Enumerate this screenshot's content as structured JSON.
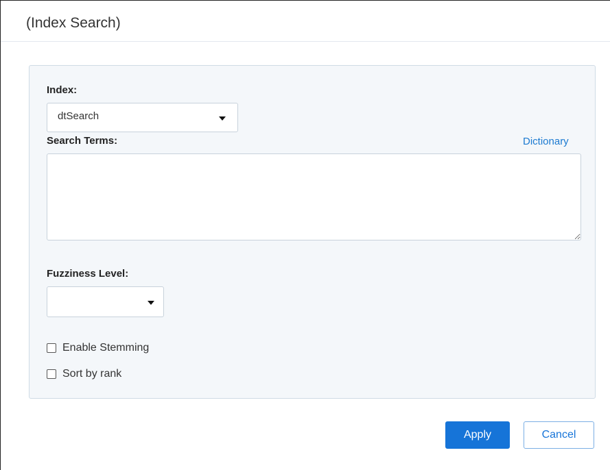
{
  "dialog": {
    "title": "(Index Search)"
  },
  "form": {
    "index_label": "Index:",
    "index_selected": "dtSearch",
    "search_terms_label": "Search Terms:",
    "dictionary_link": "Dictionary",
    "search_terms_value": "",
    "fuzziness_label": "Fuzziness Level:",
    "fuzziness_selected": "",
    "enable_stemming_label": "Enable Stemming",
    "enable_stemming_checked": false,
    "sort_by_rank_label": "Sort by rank",
    "sort_by_rank_checked": false
  },
  "footer": {
    "apply_label": "Apply",
    "cancel_label": "Cancel"
  },
  "colors": {
    "accent": "#1674d8",
    "link": "#1b7ad1",
    "panel_bg": "#f4f7fa",
    "panel_border": "#cfdbe5"
  },
  "icons": {
    "select_caret": "caret-down-icon",
    "textarea_resize": "resize-handle-icon"
  }
}
